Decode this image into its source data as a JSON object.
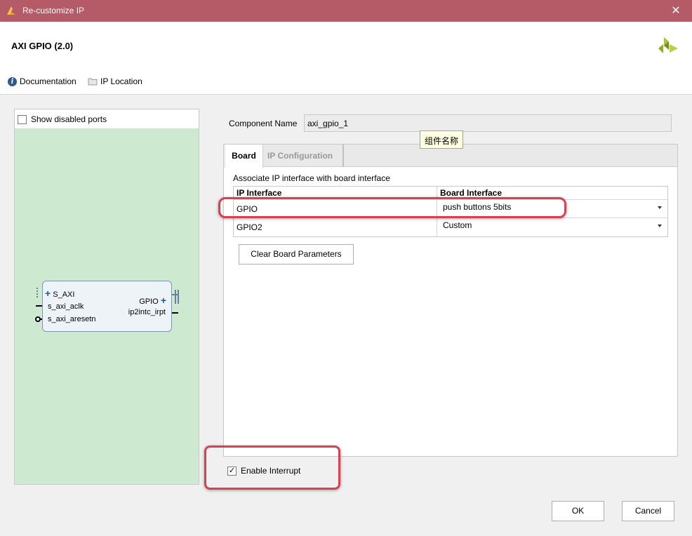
{
  "window": {
    "title": "Re-customize IP",
    "close_glyph": "✕"
  },
  "header": {
    "ip_title": "AXI GPIO (2.0)",
    "links": [
      {
        "label": "Documentation",
        "icon": "info-icon"
      },
      {
        "label": "IP Location",
        "icon": "folder-icon"
      }
    ]
  },
  "left_panel": {
    "show_disabled_ports": {
      "label": "Show disabled ports",
      "checked": false
    },
    "block": {
      "left_pins": [
        "S_AXI",
        "s_axi_aclk",
        "s_axi_aresetn"
      ],
      "right_pins": [
        "GPIO",
        "ip2intc_irpt"
      ]
    }
  },
  "form": {
    "component_name_label": "Component Name",
    "component_name_value": "axi_gpio_1",
    "tooltip": "组件名称"
  },
  "tabs": [
    {
      "label": "Board",
      "active": true
    },
    {
      "label": "IP Configuration",
      "active": false
    }
  ],
  "board": {
    "assoc_label": "Associate IP interface with board interface",
    "columns": [
      "IP Interface",
      "Board Interface"
    ],
    "rows": [
      {
        "ip": "GPIO",
        "board": "push buttons 5bits"
      },
      {
        "ip": "GPIO2",
        "board": "Custom"
      }
    ],
    "clear_button": "Clear Board Parameters"
  },
  "enable_interrupt": {
    "label": "Enable Interrupt",
    "checked": true,
    "check_glyph": "✓"
  },
  "footer": {
    "ok_label": "OK",
    "cancel_label": "Cancel"
  },
  "colors": {
    "titlebar": "#b55a67",
    "highlight": "#d9414f",
    "canvas": "#cde9cf",
    "pin_plus": "#1d5c9e",
    "logo": "#8fae2e"
  }
}
